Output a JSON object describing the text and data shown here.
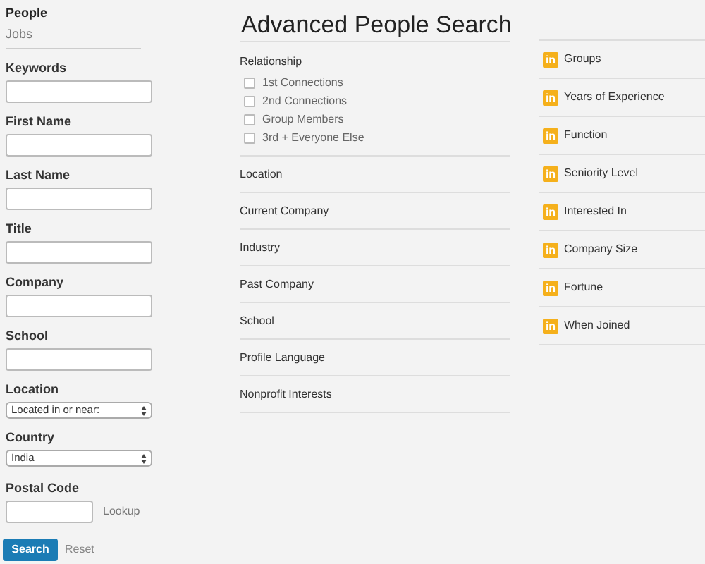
{
  "nav": [
    {
      "label": "People",
      "selected": true
    },
    {
      "label": "Jobs",
      "selected": false
    }
  ],
  "form": {
    "text_fields": [
      {
        "label": "Keywords"
      },
      {
        "label": "First Name"
      },
      {
        "label": "Last Name"
      },
      {
        "label": "Title"
      },
      {
        "label": "Company"
      },
      {
        "label": "School"
      }
    ],
    "selects": [
      {
        "label": "Location",
        "value": "Located in or near:"
      },
      {
        "label": "Country",
        "value": "India"
      }
    ],
    "postal_code": {
      "label": "Postal Code",
      "link": "Lookup"
    },
    "search_button": "Search",
    "reset": "Reset"
  },
  "title": "Advanced People Search",
  "relationship": {
    "label": "Relationship",
    "options": [
      {
        "label": "1st Connections",
        "checked": false
      },
      {
        "label": "2nd Connections",
        "checked": false
      },
      {
        "label": "Group Members",
        "checked": false
      },
      {
        "label": "3rd + Everyone Else",
        "checked": false
      }
    ]
  },
  "facets": [
    "Location",
    "Current Company",
    "Industry",
    "Past Company",
    "School",
    "Profile Language",
    "Nonprofit Interests"
  ],
  "premium_facets": [
    {
      "badge": "in",
      "label": "Groups"
    },
    {
      "badge": "in",
      "label": "Years of Experience"
    },
    {
      "badge": "in",
      "label": "Function"
    },
    {
      "badge": "in",
      "label": "Seniority Level"
    },
    {
      "badge": "in",
      "label": "Interested In"
    },
    {
      "badge": "in",
      "label": "Company Size"
    },
    {
      "badge": "in",
      "label": "Fortune"
    },
    {
      "badge": "in",
      "label": "When Joined"
    }
  ]
}
